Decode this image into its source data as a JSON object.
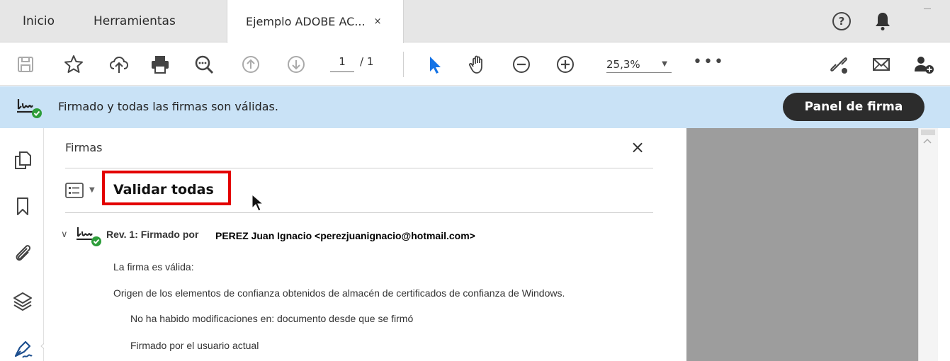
{
  "tabs": {
    "home": "Inicio",
    "tools": "Herramientas",
    "document": "Ejemplo ADOBE AC...",
    "close": "×"
  },
  "topbar": {
    "help": "?"
  },
  "toolbar": {
    "page_current": "1",
    "page_total": "/ 1",
    "zoom": "25,3%",
    "zoom_arrow": "▼",
    "more": "•••"
  },
  "banner": {
    "message": "Firmado y todas las firmas son válidas.",
    "button": "Panel de firma",
    "color": "#c9e2f6"
  },
  "panel": {
    "title": "Firmas",
    "close": "×",
    "options_caret": "▼",
    "validate_all": "Validar todas",
    "revision": {
      "chevron": "∨",
      "label": "Rev. 1: Firmado por",
      "signer": "PEREZ Juan Ignacio <perezjuanignacio@hotmail.com>",
      "details": [
        "La firma es válida:",
        "Origen de los elementos de confianza obtenidos de almacén de certificados de confianza de Windows.",
        "No ha habido modificaciones en: documento desde que se firmó",
        "Firmado por el usuario actual"
      ]
    }
  },
  "colors": {
    "accent": "#1473e6",
    "highlight": "#e30000",
    "valid": "#2d9d3a"
  }
}
